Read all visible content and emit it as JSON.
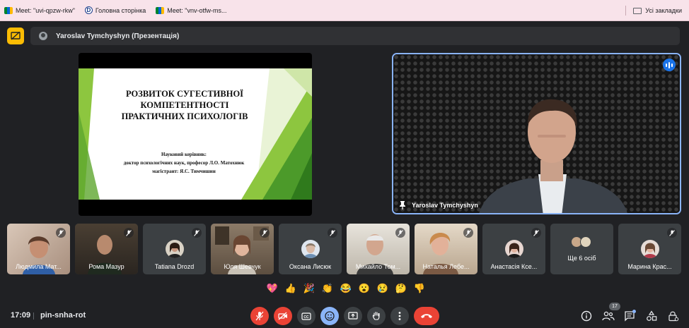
{
  "bookmarks": {
    "items": [
      {
        "label": "Meet: \"uvi-qpzw-rkw\"",
        "icon": "google-meet-icon"
      },
      {
        "label": "Головна сторінка",
        "icon": "site-d-icon"
      },
      {
        "label": "Meet: \"vnv-otfw-ms...",
        "icon": "google-meet-icon"
      }
    ],
    "all_bookmarks": "Усі закладки"
  },
  "presentation": {
    "presenter_label": "Yaroslav Tymchyshyn (Презентація)"
  },
  "slide": {
    "title_lines": [
      "РОЗВИТОК СУГЕСТИВНОЇ",
      "КОМПЕТЕНТНОСТІ",
      "ПРАКТИЧНИХ ПСИХОЛОГІВ"
    ],
    "subtitle_lines": [
      "Науковий керівник:",
      "доктор психологічних наук, професор Л.О. Матохнюк",
      "магістрант: Я.С. Тимчишин"
    ]
  },
  "speaker": {
    "name": "Yaroslav Tymchyshyn"
  },
  "participants": [
    {
      "name": "Людмила Мат...",
      "type": "video"
    },
    {
      "name": "Рома Мазур",
      "type": "video"
    },
    {
      "name": "Tatiana Drozd",
      "type": "avatar"
    },
    {
      "name": "Юля Шевчук",
      "type": "video"
    },
    {
      "name": "Оксана Лисюк",
      "type": "avatar"
    },
    {
      "name": "Михайло Том...",
      "type": "video"
    },
    {
      "name": "Наталья Лебе...",
      "type": "video"
    },
    {
      "name": "Анастасія Ксе...",
      "type": "avatar"
    },
    {
      "name": "Ще 6 осіб",
      "type": "more"
    },
    {
      "name": "Марина Крас...",
      "type": "avatar"
    }
  ],
  "reactions": [
    "💖",
    "👍",
    "🎉",
    "👏",
    "😂",
    "😮",
    "😢",
    "🤔",
    "👎"
  ],
  "meeting": {
    "time": "17:09",
    "code": "pin-snha-rot",
    "participant_count": "17"
  },
  "colors": {
    "end_call": "#ea4335",
    "active_speaker_border": "#8ab4f8",
    "presentation_icon": "#fbbc04",
    "background": "#202124"
  }
}
